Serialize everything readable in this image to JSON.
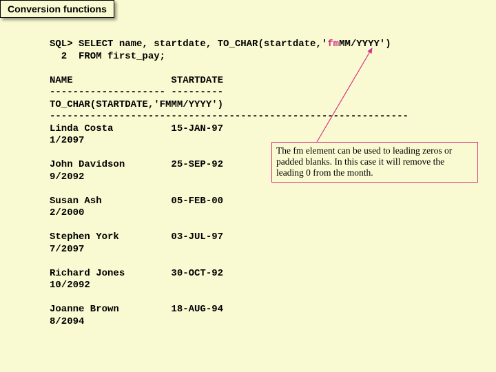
{
  "title": "Conversion functions",
  "sql": {
    "line1_pre": "SQL> SELECT name, startdate, TO_CHAR(startdate,'",
    "line1_fm": "fm",
    "line1_post": "MM/YYYY')",
    "line2": "  2  FROM first_pay;"
  },
  "headers": {
    "name": "NAME                 STARTDATE",
    "dash1": "-------------------- ---------",
    "tchar": "TO_CHAR(STARTDATE,'FMMM/YYYY')",
    "dash2": "--------------------------------------------------------------"
  },
  "rows": [
    {
      "a": "Linda Costa          15-JAN-97",
      "b": "1/2097"
    },
    {
      "a": "John Davidson        25-SEP-92",
      "b": "9/2092"
    },
    {
      "a": "Susan Ash            05-FEB-00",
      "b": "2/2000"
    },
    {
      "a": "Stephen York         03-JUL-97",
      "b": "7/2097"
    },
    {
      "a": "Richard Jones        30-OCT-92",
      "b": "10/2092"
    },
    {
      "a": "Joanne Brown         18-AUG-94",
      "b": "8/2094"
    }
  ],
  "callout": "The fm element can be used to leading zeros or padded blanks.  In this case it will remove the leading 0 from the month."
}
